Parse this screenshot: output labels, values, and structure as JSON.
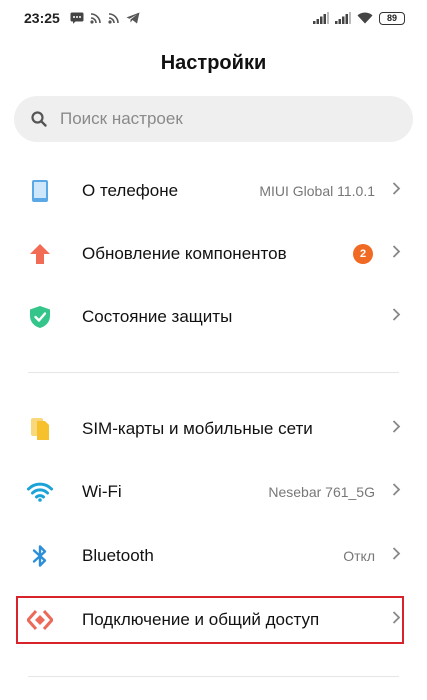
{
  "status_bar": {
    "time": "23:25",
    "battery": "89",
    "icons_left": [
      "message-icon",
      "wifi-calling-icon",
      "wifi-calling-icon",
      "telegram-icon"
    ],
    "icons_right": [
      "signal-icon",
      "signal-icon",
      "wifi-icon",
      "battery-icon"
    ]
  },
  "header": {
    "title": "Настройки"
  },
  "search": {
    "placeholder": "Поиск настроек"
  },
  "section1": [
    {
      "id": "about-phone",
      "label": "О телефоне",
      "value": "MIUI Global 11.0.1",
      "icon": "phone-icon",
      "color": "#5aa8e6"
    },
    {
      "id": "component-update",
      "label": "Обновление компонентов",
      "badge": "2",
      "icon": "update-arrow-icon",
      "color": "#f26b55"
    },
    {
      "id": "security-status",
      "label": "Состояние защиты",
      "icon": "shield-check-icon",
      "color": "#34c58a"
    }
  ],
  "section2": [
    {
      "id": "sim-cards",
      "label": "SIM-карты и мобильные сети",
      "icon": "sim-card-icon",
      "color": "#f6c12c"
    },
    {
      "id": "wifi",
      "label": "Wi-Fi",
      "value": "Nesebar 761_5G",
      "icon": "wifi-icon",
      "color": "#1ba3d8"
    },
    {
      "id": "bluetooth",
      "label": "Bluetooth",
      "value": "Откл",
      "icon": "bluetooth-icon",
      "color": "#2d8fd8"
    },
    {
      "id": "connection-sharing",
      "label": "Подключение и общий доступ",
      "icon": "connection-sharing-icon",
      "color": "#ec6a5a",
      "highlighted": true
    }
  ],
  "colors": {
    "highlight": "#d9232b",
    "badge": "#f06a23"
  }
}
